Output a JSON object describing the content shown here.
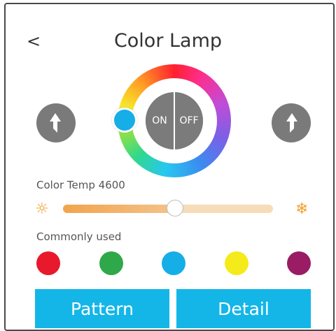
{
  "header": {
    "back_label": "<",
    "title": "Color Lamp"
  },
  "power": {
    "on_label": "ON",
    "off_label": "OFF"
  },
  "color_wheel": {
    "selected_color": "#15aee6"
  },
  "nav": {
    "left_icon": "arrow-up-left-icon",
    "right_icon": "arrow-up-right-icon"
  },
  "color_temp": {
    "label": "Color Temp 4600",
    "value_fraction": 0.53,
    "warm_icon": "sun-icon",
    "warm_glyph": "☼",
    "cool_icon": "snowflake-icon",
    "cool_glyph": "❄"
  },
  "common": {
    "label": "Commonly used",
    "colors": [
      "#e8192c",
      "#2fa84a",
      "#15aee6",
      "#f5ea1a",
      "#9a1c64"
    ]
  },
  "actions": {
    "pattern_label": "Pattern",
    "detail_label": "Detail"
  },
  "colors": {
    "accent": "#14b6e8",
    "gray": "#7a7a7a",
    "warm": "#f0a030"
  }
}
